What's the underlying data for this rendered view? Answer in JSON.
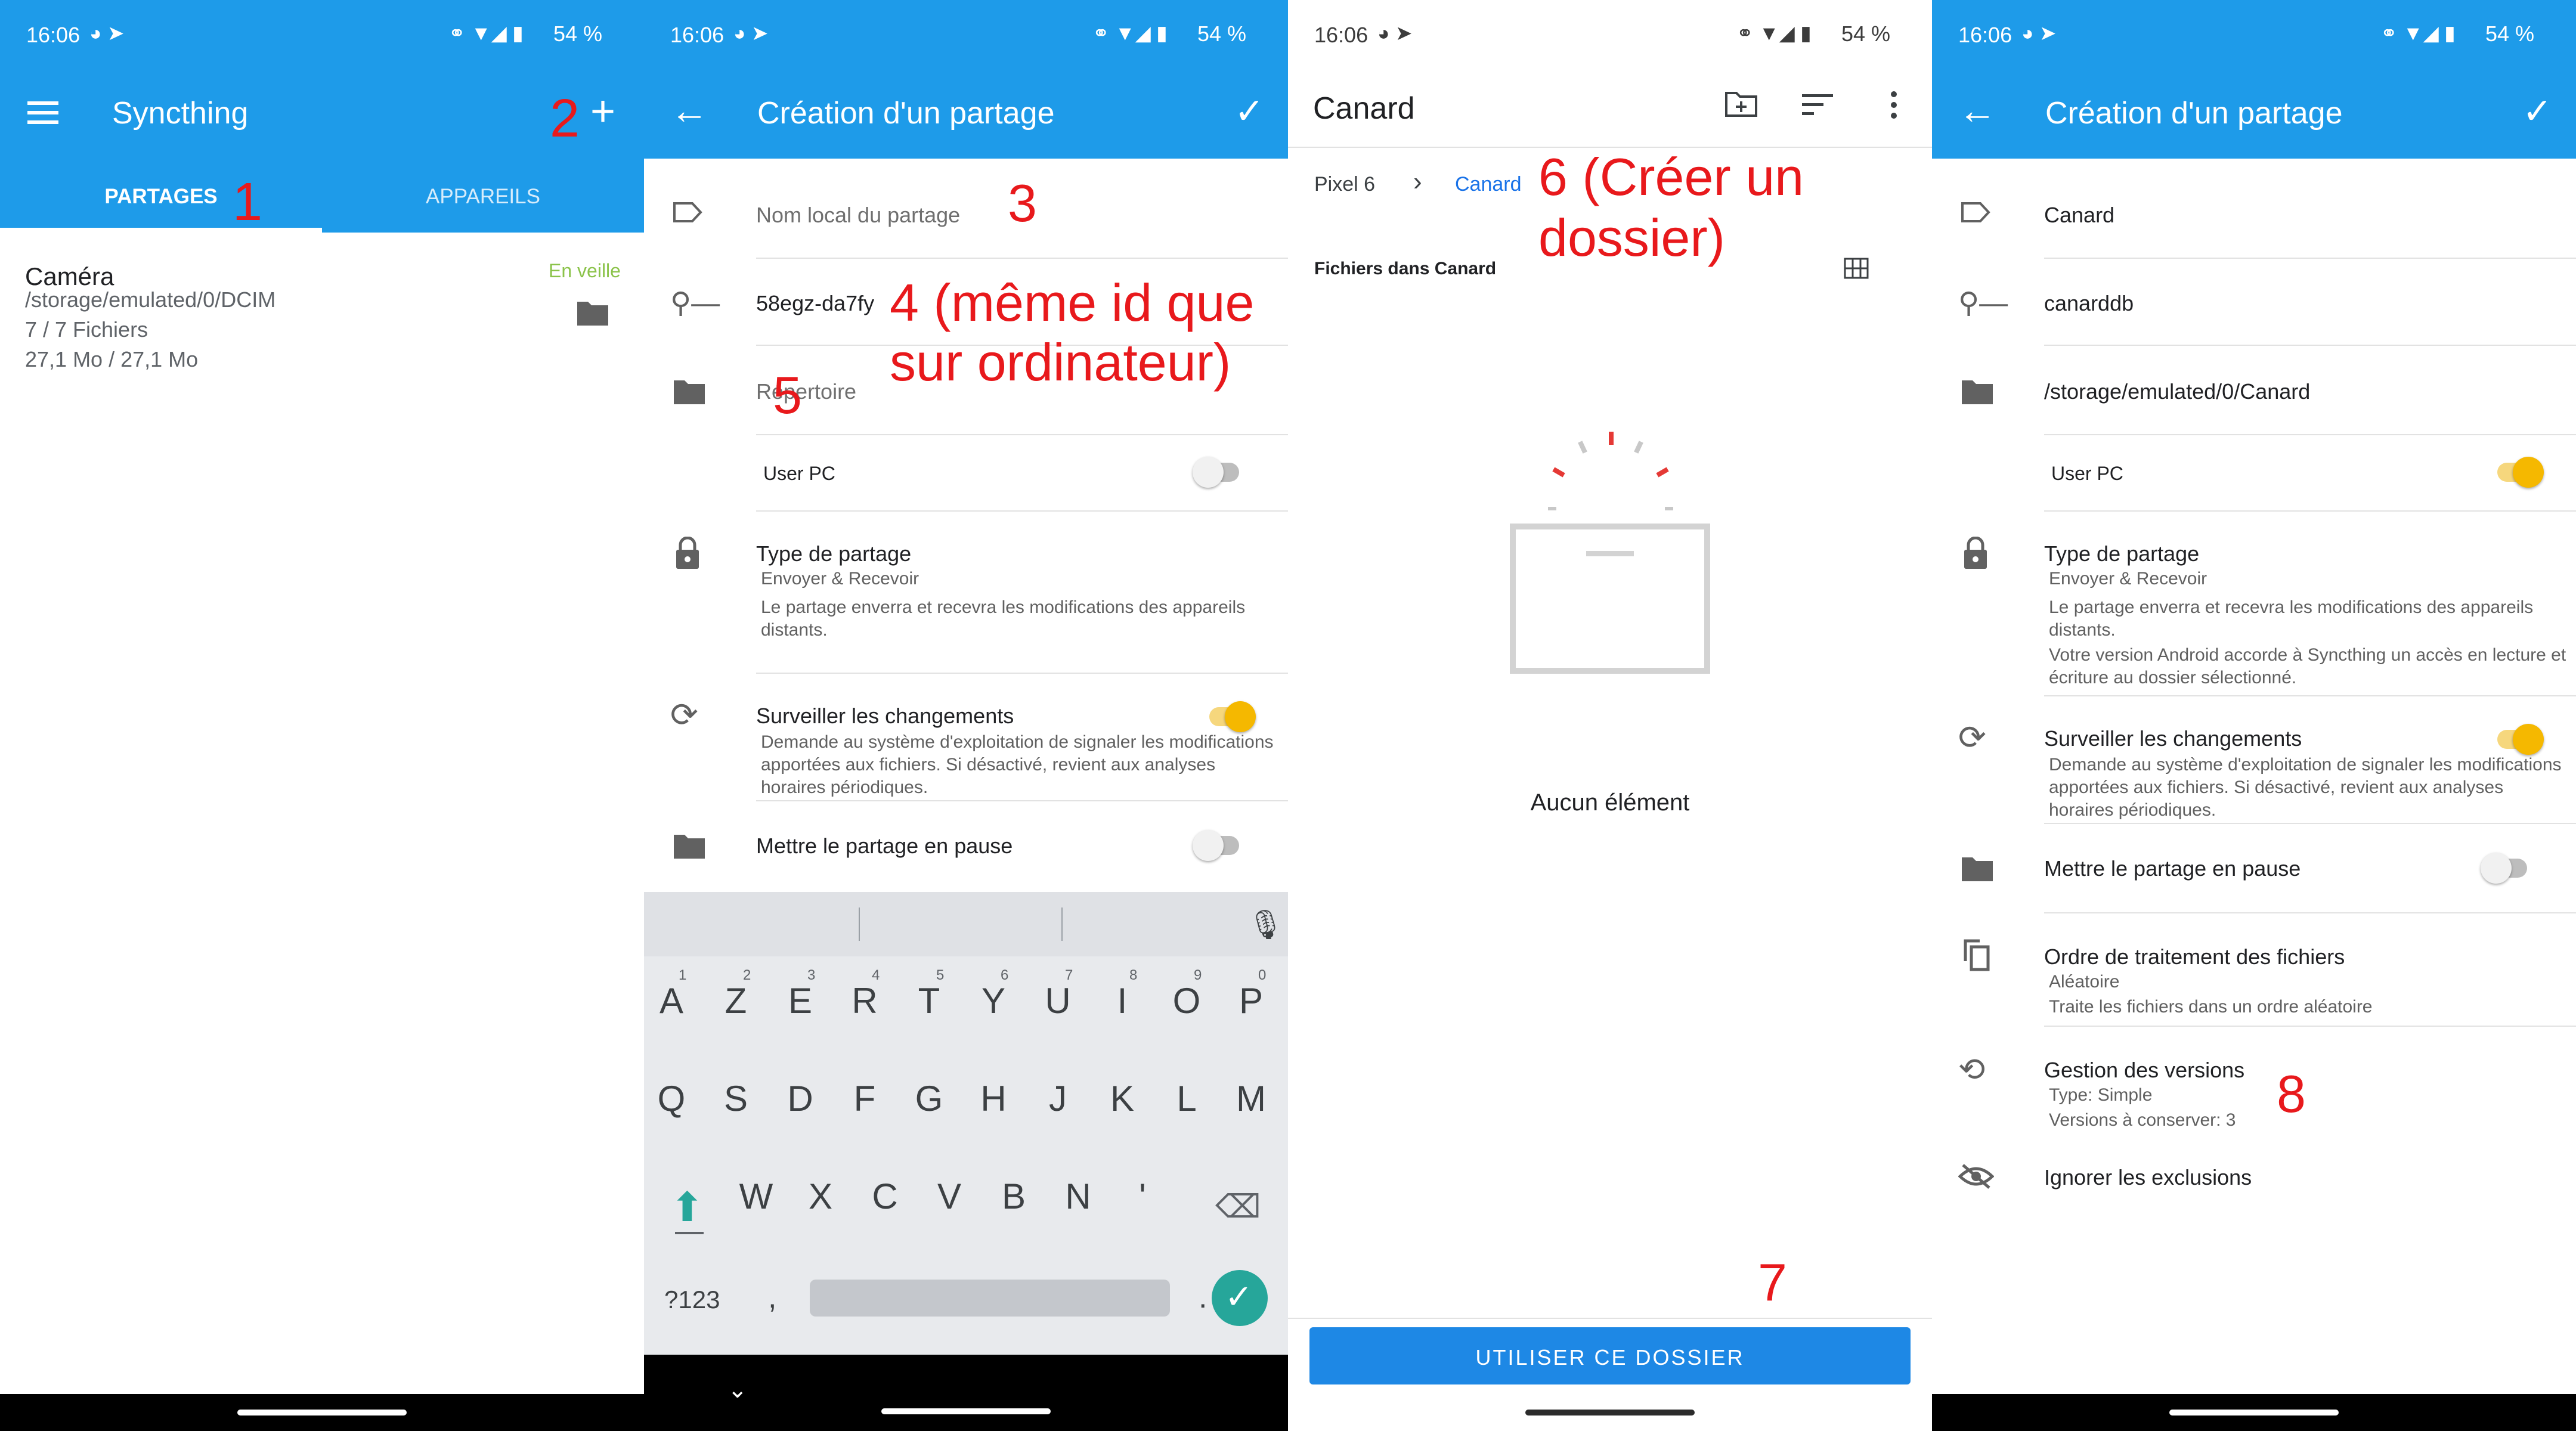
{
  "panel1": {
    "time": "16:06",
    "battery": "54 %",
    "title": "Syncthing",
    "tabs": [
      "PARTAGES",
      "APPAREILS"
    ],
    "folder": {
      "name": "Caméra",
      "status": "En veille",
      "path": "/storage/emulated/0/DCIM",
      "files": "7 / 7 Fichiers",
      "size": "27,1 Mo / 27,1 Mo"
    },
    "annotations": {
      "a1": "1",
      "a2": "2"
    }
  },
  "panel2": {
    "time": "16:06",
    "battery": "54 %",
    "title": "Création d'un partage",
    "label_placeholder": "Nom local du partage",
    "id_value": "58egz-da7fy",
    "directory_placeholder": "Répertoire",
    "device": "User PC",
    "share_type": {
      "title": "Type de partage",
      "value": "Envoyer & Recevoir",
      "desc": "Le partage enverra et recevra les modifications des appareils distants."
    },
    "watch": {
      "title": "Surveiller les changements",
      "desc": "Demande au système d'exploitation de signaler les modifications apportées aux fichiers. Si désactivé, revient aux analyses horaires périodiques."
    },
    "pause": "Mettre le partage en pause",
    "keyboard": {
      "row1": [
        "A",
        "Z",
        "E",
        "R",
        "T",
        "Y",
        "U",
        "I",
        "O",
        "P"
      ],
      "row1_nums": [
        "1",
        "2",
        "3",
        "4",
        "5",
        "6",
        "7",
        "8",
        "9",
        "0"
      ],
      "row2": [
        "Q",
        "S",
        "D",
        "F",
        "G",
        "H",
        "J",
        "K",
        "L",
        "M"
      ],
      "row3": [
        "W",
        "X",
        "C",
        "V",
        "B",
        "N",
        "'"
      ],
      "symbols": "?123",
      "comma": ",",
      "period": "."
    },
    "annotations": {
      "a3": "3",
      "a4": "4 (même id que sur ordinateur)",
      "a5": "5"
    }
  },
  "panel3": {
    "time": "16:06",
    "battery": "54 %",
    "title": "Canard",
    "breadcrumb": [
      "Pixel 6",
      "Canard"
    ],
    "files_header": "Fichiers dans Canard",
    "empty": "Aucun élément",
    "button": "UTILISER CE DOSSIER",
    "annotations": {
      "a6": "6 (Créer un dossier)",
      "a7": "7"
    }
  },
  "panel4": {
    "time": "16:06",
    "battery": "54 %",
    "title": "Création d'un partage",
    "label_value": "Canard",
    "id_value": "canarddb",
    "directory_value": "/storage/emulated/0/Canard",
    "device": "User PC",
    "share_type": {
      "title": "Type de partage",
      "value": "Envoyer & Recevoir",
      "desc": "Le partage enverra et recevra les modifications des appareils distants.",
      "note": "Votre version Android accorde à Syncthing un accès en lecture et écriture au dossier sélectionné."
    },
    "watch": {
      "title": "Surveiller les changements",
      "desc": "Demande au système d'exploitation de signaler les modifications apportées aux fichiers. Si désactivé, revient aux analyses horaires périodiques."
    },
    "pause": "Mettre le partage en pause",
    "order": {
      "title": "Ordre de traitement des fichiers",
      "value": "Aléatoire",
      "desc": "Traite les fichiers dans un ordre aléatoire"
    },
    "versions": {
      "title": "Gestion des versions",
      "type": "Type: Simple",
      "keep": "Versions à conserver: 3"
    },
    "ignore": "Ignorer les exclusions",
    "annotations": {
      "a8": "8"
    }
  },
  "colors": {
    "accent": "#1e9be9",
    "annotation": "#e8191c",
    "toggle_on": "#f5b800",
    "status_idle": "#8bc34a",
    "button_blue": "#1e88e5"
  }
}
